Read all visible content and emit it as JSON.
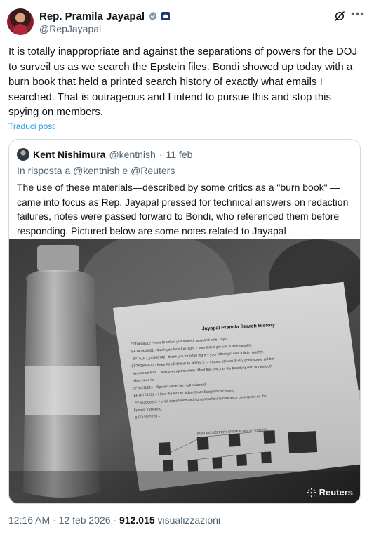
{
  "post": {
    "author_name": "Rep. Pramila Jayapal",
    "author_handle": "@RepJayapal",
    "text": "It is totally inappropriate and against the separations of powers for the DOJ to surveil us as we search the Epstein files. Bondi showed up today with a burn book that held a printed search history of exactly what emails I searched. That is outrageous and I intend to pursue this and stop this spying on members.",
    "translate_label": "Traduci post",
    "time": "12:16 AM",
    "date": "12 feb 2026",
    "views_count": "912.015",
    "views_label": "visualizzazioni",
    "separator": "·"
  },
  "quoted": {
    "author_name": "Kent Nishimura",
    "author_handle": "@kentnish",
    "date": "11 feb",
    "separator": "·",
    "reply_prefix": "In risposta a",
    "reply_mention_1": "@kentnish",
    "reply_conj": "e",
    "reply_mention_2": "@Reuters",
    "text": "The use of these materials—described by some critics as a \"burn book\" — came into focus as Rep. Jayapal pressed for technical answers on redaction failures, notes were passed forward to Bondi, who referenced them before responding. Pictured below are some notes related to Jayapal",
    "photo": {
      "credit": "Reuters",
      "paper_title": "Jayapal Pramila Search History",
      "paper_lines": [
        "EFTA659212 – new Brazilian just arrived, sexy and cute, 18yo",
        "EFTA1930501 - thank you for a fun night – your littlest girl was a little naughty.",
        "EFTA_R1_00380742 - thank you for a fun night – your littlest girl was a little naughty.",
        "EFTA2504630 - From Kira Dikhtyar to Jeffrey E – \"I found at least 3 very good young girl but",
        "we was so tired. I will cover up this week. Meet this one, not the beauty queen but we both",
        "likes her a lot.",
        "EFTA211214 – Epstein victim list – all redacted.",
        "EFTA774231 – I love the torture video. From Sutayem to Epstein.",
        "EFTA1660622 – child exploitation and human trafficking task force powerpoint on the",
        "Epstein trafficking.",
        "EFTA1682079 –"
      ],
      "paper_footer": "(U)(FOUO) JEFFERY EPSTEIN AKA MY-2021072"
    }
  },
  "icons": {
    "verified": "verified-badge-icon",
    "government": "government-badge-icon",
    "grok": "grok-icon",
    "more": "more-options-icon",
    "reuters": "reuters-logo-icon"
  },
  "colors": {
    "link": "#1d9bf0",
    "secondary_text": "#536471",
    "border": "#cfd9de"
  }
}
